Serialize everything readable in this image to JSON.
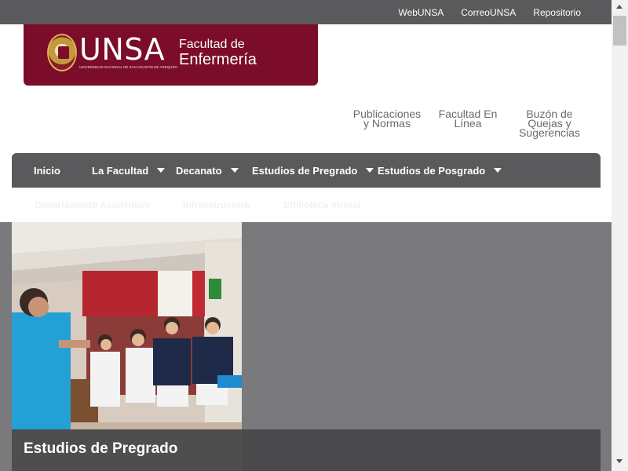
{
  "top_links": [
    "WebUNSA",
    "CorreoUNSA",
    "Repositorio"
  ],
  "logo": {
    "acronym": "UNSA",
    "university": "UNIVERSIDAD NACIONAL DE SAN AGUSTÍN DE AREQUIPA",
    "faculty_line1": "Facultad de",
    "faculty_line2": "Enfermería"
  },
  "quick_links": [
    {
      "lines": [
        "Publicaciones",
        "y Normas"
      ]
    },
    {
      "lines": [
        "Facultad En",
        "Línea"
      ]
    },
    {
      "lines": [
        "Buzón de",
        "Quejas y",
        "Sugerencias"
      ]
    }
  ],
  "main_nav": [
    {
      "label": "Inicio",
      "dropdown": false
    },
    {
      "label": "La Facultad",
      "dropdown": true
    },
    {
      "label": "Decanato",
      "dropdown": true
    },
    {
      "label": "Estudios de Pregrado",
      "dropdown": true
    },
    {
      "label": "Estudios de Posgrado",
      "dropdown": true
    }
  ],
  "sub_nav": [
    "Departamento Académico",
    "Infraestructura",
    "Biblioteca Virtual"
  ],
  "hero": {
    "caption": "Estudios de Pregrado"
  },
  "colors": {
    "topbar": "#5a595b",
    "brand": "#7b0c2a",
    "hero_bg": "#7a797c"
  }
}
